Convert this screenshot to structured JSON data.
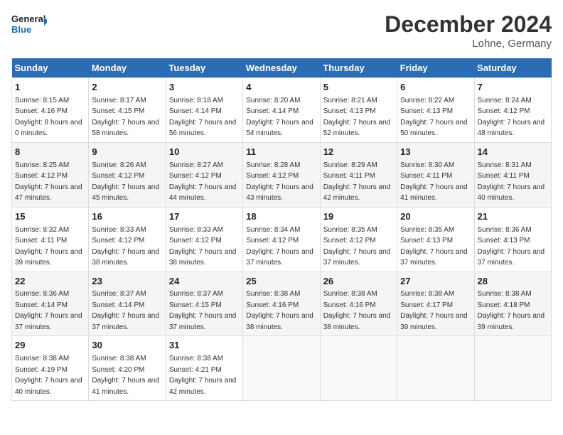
{
  "header": {
    "logo_line1": "General",
    "logo_line2": "Blue",
    "month_title": "December 2024",
    "subtitle": "Lohne, Germany"
  },
  "days_of_week": [
    "Sunday",
    "Monday",
    "Tuesday",
    "Wednesday",
    "Thursday",
    "Friday",
    "Saturday"
  ],
  "weeks": [
    [
      {
        "day": "1",
        "sunrise": "Sunrise: 8:15 AM",
        "sunset": "Sunset: 4:16 PM",
        "daylight": "Daylight: 8 hours and 0 minutes."
      },
      {
        "day": "2",
        "sunrise": "Sunrise: 8:17 AM",
        "sunset": "Sunset: 4:15 PM",
        "daylight": "Daylight: 7 hours and 58 minutes."
      },
      {
        "day": "3",
        "sunrise": "Sunrise: 8:18 AM",
        "sunset": "Sunset: 4:14 PM",
        "daylight": "Daylight: 7 hours and 56 minutes."
      },
      {
        "day": "4",
        "sunrise": "Sunrise: 8:20 AM",
        "sunset": "Sunset: 4:14 PM",
        "daylight": "Daylight: 7 hours and 54 minutes."
      },
      {
        "day": "5",
        "sunrise": "Sunrise: 8:21 AM",
        "sunset": "Sunset: 4:13 PM",
        "daylight": "Daylight: 7 hours and 52 minutes."
      },
      {
        "day": "6",
        "sunrise": "Sunrise: 8:22 AM",
        "sunset": "Sunset: 4:13 PM",
        "daylight": "Daylight: 7 hours and 50 minutes."
      },
      {
        "day": "7",
        "sunrise": "Sunrise: 8:24 AM",
        "sunset": "Sunset: 4:12 PM",
        "daylight": "Daylight: 7 hours and 48 minutes."
      }
    ],
    [
      {
        "day": "8",
        "sunrise": "Sunrise: 8:25 AM",
        "sunset": "Sunset: 4:12 PM",
        "daylight": "Daylight: 7 hours and 47 minutes."
      },
      {
        "day": "9",
        "sunrise": "Sunrise: 8:26 AM",
        "sunset": "Sunset: 4:12 PM",
        "daylight": "Daylight: 7 hours and 45 minutes."
      },
      {
        "day": "10",
        "sunrise": "Sunrise: 8:27 AM",
        "sunset": "Sunset: 4:12 PM",
        "daylight": "Daylight: 7 hours and 44 minutes."
      },
      {
        "day": "11",
        "sunrise": "Sunrise: 8:28 AM",
        "sunset": "Sunset: 4:12 PM",
        "daylight": "Daylight: 7 hours and 43 minutes."
      },
      {
        "day": "12",
        "sunrise": "Sunrise: 8:29 AM",
        "sunset": "Sunset: 4:11 PM",
        "daylight": "Daylight: 7 hours and 42 minutes."
      },
      {
        "day": "13",
        "sunrise": "Sunrise: 8:30 AM",
        "sunset": "Sunset: 4:11 PM",
        "daylight": "Daylight: 7 hours and 41 minutes."
      },
      {
        "day": "14",
        "sunrise": "Sunrise: 8:31 AM",
        "sunset": "Sunset: 4:11 PM",
        "daylight": "Daylight: 7 hours and 40 minutes."
      }
    ],
    [
      {
        "day": "15",
        "sunrise": "Sunrise: 8:32 AM",
        "sunset": "Sunset: 4:11 PM",
        "daylight": "Daylight: 7 hours and 39 minutes."
      },
      {
        "day": "16",
        "sunrise": "Sunrise: 8:33 AM",
        "sunset": "Sunset: 4:12 PM",
        "daylight": "Daylight: 7 hours and 38 minutes."
      },
      {
        "day": "17",
        "sunrise": "Sunrise: 8:33 AM",
        "sunset": "Sunset: 4:12 PM",
        "daylight": "Daylight: 7 hours and 38 minutes."
      },
      {
        "day": "18",
        "sunrise": "Sunrise: 8:34 AM",
        "sunset": "Sunset: 4:12 PM",
        "daylight": "Daylight: 7 hours and 37 minutes."
      },
      {
        "day": "19",
        "sunrise": "Sunrise: 8:35 AM",
        "sunset": "Sunset: 4:12 PM",
        "daylight": "Daylight: 7 hours and 37 minutes."
      },
      {
        "day": "20",
        "sunrise": "Sunrise: 8:35 AM",
        "sunset": "Sunset: 4:13 PM",
        "daylight": "Daylight: 7 hours and 37 minutes."
      },
      {
        "day": "21",
        "sunrise": "Sunrise: 8:36 AM",
        "sunset": "Sunset: 4:13 PM",
        "daylight": "Daylight: 7 hours and 37 minutes."
      }
    ],
    [
      {
        "day": "22",
        "sunrise": "Sunrise: 8:36 AM",
        "sunset": "Sunset: 4:14 PM",
        "daylight": "Daylight: 7 hours and 37 minutes."
      },
      {
        "day": "23",
        "sunrise": "Sunrise: 8:37 AM",
        "sunset": "Sunset: 4:14 PM",
        "daylight": "Daylight: 7 hours and 37 minutes."
      },
      {
        "day": "24",
        "sunrise": "Sunrise: 8:37 AM",
        "sunset": "Sunset: 4:15 PM",
        "daylight": "Daylight: 7 hours and 37 minutes."
      },
      {
        "day": "25",
        "sunrise": "Sunrise: 8:38 AM",
        "sunset": "Sunset: 4:16 PM",
        "daylight": "Daylight: 7 hours and 38 minutes."
      },
      {
        "day": "26",
        "sunrise": "Sunrise: 8:38 AM",
        "sunset": "Sunset: 4:16 PM",
        "daylight": "Daylight: 7 hours and 38 minutes."
      },
      {
        "day": "27",
        "sunrise": "Sunrise: 8:38 AM",
        "sunset": "Sunset: 4:17 PM",
        "daylight": "Daylight: 7 hours and 39 minutes."
      },
      {
        "day": "28",
        "sunrise": "Sunrise: 8:38 AM",
        "sunset": "Sunset: 4:18 PM",
        "daylight": "Daylight: 7 hours and 39 minutes."
      }
    ],
    [
      {
        "day": "29",
        "sunrise": "Sunrise: 8:38 AM",
        "sunset": "Sunset: 4:19 PM",
        "daylight": "Daylight: 7 hours and 40 minutes."
      },
      {
        "day": "30",
        "sunrise": "Sunrise: 8:38 AM",
        "sunset": "Sunset: 4:20 PM",
        "daylight": "Daylight: 7 hours and 41 minutes."
      },
      {
        "day": "31",
        "sunrise": "Sunrise: 8:38 AM",
        "sunset": "Sunset: 4:21 PM",
        "daylight": "Daylight: 7 hours and 42 minutes."
      },
      null,
      null,
      null,
      null
    ]
  ]
}
